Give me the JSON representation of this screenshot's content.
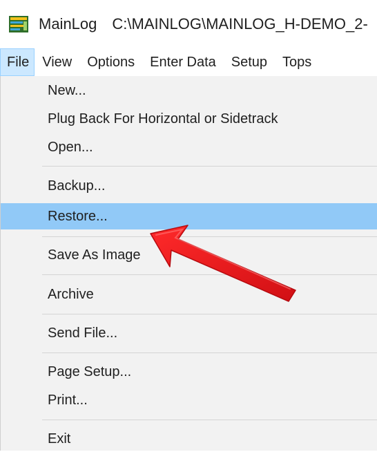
{
  "window": {
    "app_name": "MainLog",
    "path": "C:\\MAINLOG\\MAINLOG_H-DEMO_2-"
  },
  "menubar": {
    "items": [
      {
        "label": "File"
      },
      {
        "label": "View"
      },
      {
        "label": "Options"
      },
      {
        "label": "Enter Data"
      },
      {
        "label": "Setup"
      },
      {
        "label": "Tops"
      }
    ]
  },
  "file_menu": {
    "items": [
      {
        "label": "New..."
      },
      {
        "label": "Plug Back For Horizontal or Sidetrack"
      },
      {
        "label": "Open..."
      },
      {
        "label": "Backup..."
      },
      {
        "label": "Restore..."
      },
      {
        "label": "Save As Image"
      },
      {
        "label": "Archive"
      },
      {
        "label": "Send File..."
      },
      {
        "label": "Page Setup..."
      },
      {
        "label": "Print..."
      },
      {
        "label": "Exit"
      }
    ],
    "highlighted": "Restore..."
  },
  "colors": {
    "highlight": "#91c9f7",
    "arrow": "#e8151b",
    "menu_background": "#f2f2f2"
  },
  "icons": {
    "app": "mainlog-app-icon",
    "annotation": "red-arrow-icon"
  }
}
